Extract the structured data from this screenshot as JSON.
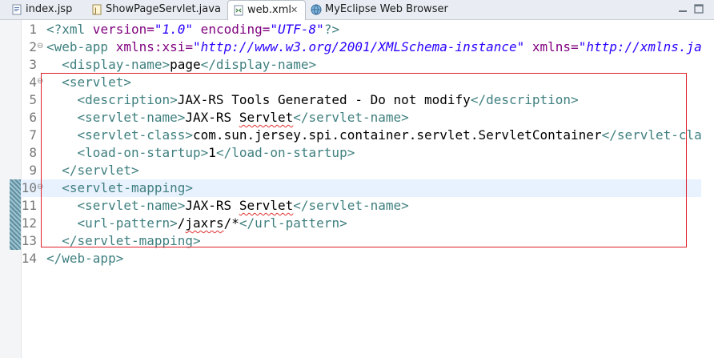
{
  "tabs": [
    {
      "label": "index.jsp",
      "icon": "jsp-file-icon"
    },
    {
      "label": "ShowPageServlet.java",
      "icon": "java-file-icon"
    },
    {
      "label": "web.xml",
      "icon": "xml-file-icon",
      "active": true
    },
    {
      "label": "MyEclipse Web Browser",
      "icon": "globe-icon"
    }
  ],
  "tab_close_glyph": "✕",
  "lines": [
    {
      "no": "1",
      "fold": "",
      "tokens": [
        {
          "t": "<?",
          "c": "t-pi"
        },
        {
          "t": "xml",
          "c": "t-pi"
        },
        {
          "t": " version=",
          "c": "t-attr"
        },
        {
          "t": "\"1.0\"",
          "c": "t-str"
        },
        {
          "t": " encoding=",
          "c": "t-attr"
        },
        {
          "t": "\"UTF-8\"",
          "c": "t-str"
        },
        {
          "t": "?>",
          "c": "t-pi"
        }
      ]
    },
    {
      "no": "2",
      "fold": "⊖",
      "tokens": [
        {
          "t": "<web-app",
          "c": "t-tag"
        },
        {
          "t": " xmlns:xsi=",
          "c": "t-attr"
        },
        {
          "t": "\"http://www.w3.org/2001/XMLSchema-instance\"",
          "c": "t-str"
        },
        {
          "t": " xmlns=",
          "c": "t-attr"
        },
        {
          "t": "\"http://xmlns.jav",
          "c": "t-str"
        }
      ]
    },
    {
      "no": "3",
      "fold": "",
      "tokens": [
        {
          "t": "  ",
          "c": "t-txt"
        },
        {
          "t": "<display-name>",
          "c": "t-tag"
        },
        {
          "t": "page",
          "c": "t-txt"
        },
        {
          "t": "</display-name>",
          "c": "t-tag"
        }
      ]
    },
    {
      "no": "4",
      "fold": "⊖",
      "tokens": [
        {
          "t": "  ",
          "c": "t-txt"
        },
        {
          "t": "<servlet>",
          "c": "t-tag"
        }
      ]
    },
    {
      "no": "5",
      "fold": "",
      "tokens": [
        {
          "t": "    ",
          "c": "t-txt"
        },
        {
          "t": "<description>",
          "c": "t-tag"
        },
        {
          "t": "JAX-RS Tools Generated - Do not modify",
          "c": "t-txt"
        },
        {
          "t": "</description>",
          "c": "t-tag"
        }
      ]
    },
    {
      "no": "6",
      "fold": "",
      "tokens": [
        {
          "t": "    ",
          "c": "t-txt"
        },
        {
          "t": "<servlet-name>",
          "c": "t-tag"
        },
        {
          "t": "JAX-RS ",
          "c": "t-txt"
        },
        {
          "t": "Servlet",
          "c": "t-txt spell"
        },
        {
          "t": "</servlet-name>",
          "c": "t-tag"
        }
      ]
    },
    {
      "no": "7",
      "fold": "",
      "tokens": [
        {
          "t": "    ",
          "c": "t-txt"
        },
        {
          "t": "<servlet-class>",
          "c": "t-tag"
        },
        {
          "t": "com.sun.jersey.spi.container.servlet.ServletContainer",
          "c": "t-txt"
        },
        {
          "t": "</servlet-class>",
          "c": "t-tag"
        }
      ]
    },
    {
      "no": "8",
      "fold": "",
      "tokens": [
        {
          "t": "    ",
          "c": "t-txt"
        },
        {
          "t": "<load-on-startup>",
          "c": "t-tag"
        },
        {
          "t": "1",
          "c": "t-txt"
        },
        {
          "t": "</load-on-startup>",
          "c": "t-tag"
        }
      ]
    },
    {
      "no": "9",
      "fold": "",
      "tokens": [
        {
          "t": "  ",
          "c": "t-txt"
        },
        {
          "t": "</servlet>",
          "c": "t-tag"
        }
      ]
    },
    {
      "no": "10",
      "fold": "⊖",
      "tokens": [
        {
          "t": "  ",
          "c": "t-txt"
        },
        {
          "t": "<servlet-mapping>",
          "c": "t-tag"
        }
      ]
    },
    {
      "no": "11",
      "fold": "",
      "tokens": [
        {
          "t": "    ",
          "c": "t-txt"
        },
        {
          "t": "<servlet-name>",
          "c": "t-tag"
        },
        {
          "t": "JAX-RS ",
          "c": "t-txt"
        },
        {
          "t": "Servlet",
          "c": "t-txt spell"
        },
        {
          "t": "</servlet-name>",
          "c": "t-tag"
        }
      ]
    },
    {
      "no": "12",
      "fold": "",
      "tokens": [
        {
          "t": "    ",
          "c": "t-txt"
        },
        {
          "t": "<url-pattern>",
          "c": "t-tag"
        },
        {
          "t": "/",
          "c": "t-txt"
        },
        {
          "t": "jaxrs",
          "c": "t-txt spell"
        },
        {
          "t": "/*",
          "c": "t-txt"
        },
        {
          "t": "</url-pattern>",
          "c": "t-tag"
        }
      ]
    },
    {
      "no": "13",
      "fold": "",
      "tokens": [
        {
          "t": "  ",
          "c": "t-txt"
        },
        {
          "t": "</servlet-mapping>",
          "c": "t-tag"
        }
      ]
    },
    {
      "no": "14",
      "fold": "",
      "tokens": [
        {
          "t": "</web-app>",
          "c": "t-tag"
        }
      ]
    }
  ]
}
